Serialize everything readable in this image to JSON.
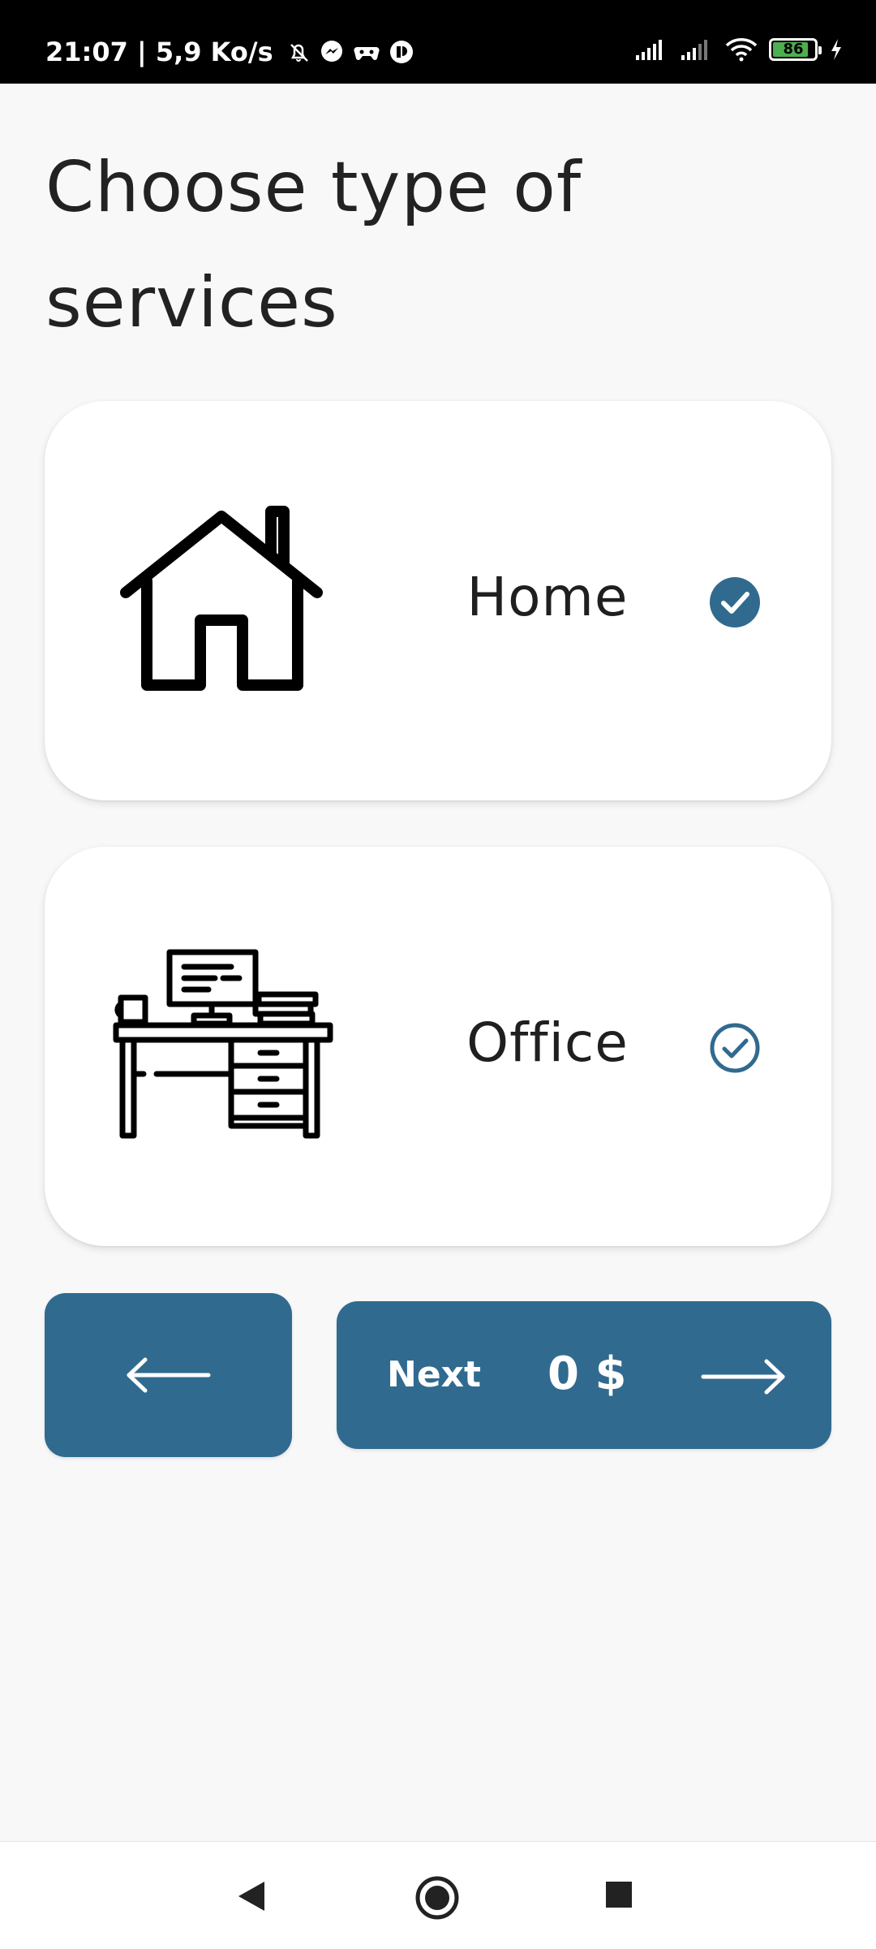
{
  "status_bar": {
    "time_speed": "21:07 | 5,9 Ko/s",
    "battery_level": "86",
    "battery_percent": 86
  },
  "page": {
    "title": "Choose type of services"
  },
  "services": [
    {
      "label": "Home",
      "icon": "house-icon",
      "selected": true
    },
    {
      "label": "Office",
      "icon": "office-desk-icon",
      "selected": false
    }
  ],
  "actions": {
    "back_icon": "arrow-left-icon",
    "next_label": "Next",
    "price": "0 $",
    "next_icon": "arrow-right-icon"
  },
  "colors": {
    "accent": "#316a8f",
    "background": "#f8f8f8",
    "card": "#ffffff",
    "text": "#1f1f1f"
  }
}
